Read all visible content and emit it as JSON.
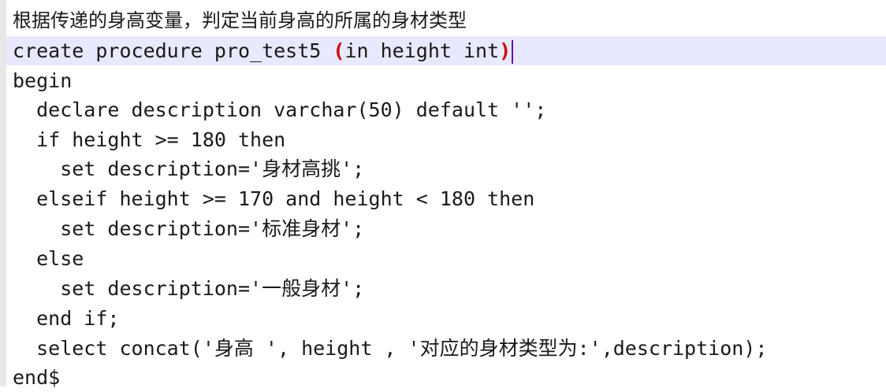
{
  "editor": {
    "comment": "根据传递的身高变量，判定当前身高的所属的身材类型",
    "lines": [
      "create procedure pro_test5",
      "in height int",
      "begin",
      "  declare description varchar(50) default '';",
      "  if height >= 180 then",
      "    set description='身材高挑';",
      "  elseif height >= 170 and height < 180 then",
      "    set description='标准身材';",
      "  else",
      "    set description='一般身材';",
      "  end if;",
      "  select concat('身高 ', height , '对应的身材类型为:',description);",
      "end$"
    ],
    "open_paren": "(",
    "close_paren": ")",
    "space": " "
  },
  "colors": {
    "background": "#ffffff",
    "active_line": "#e8e8ff",
    "bracket_highlight": "#d10000",
    "caret": "#6a0dad",
    "text": "#1a1a1a"
  }
}
